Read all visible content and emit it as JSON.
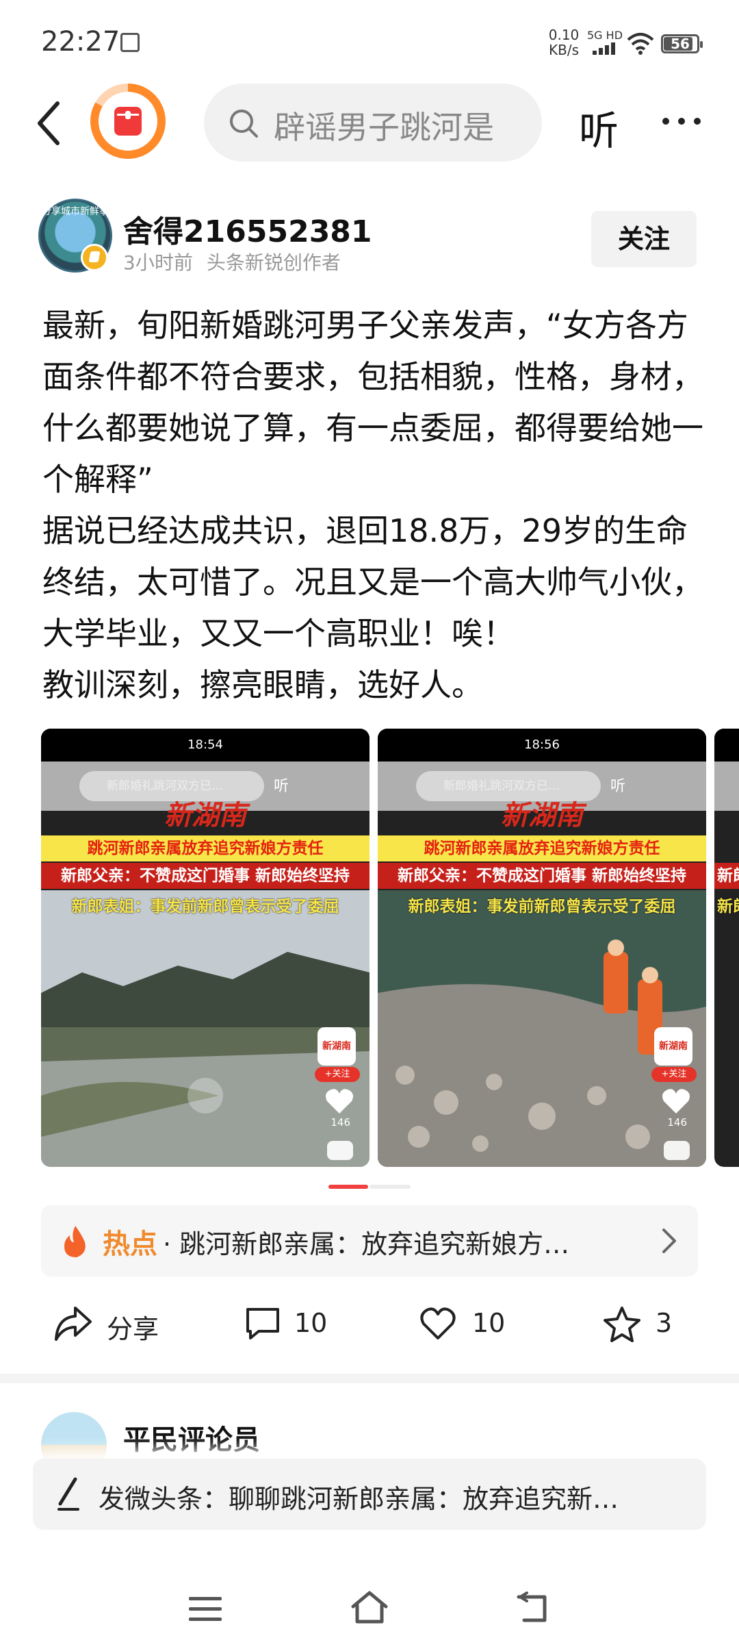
{
  "status_bar": {
    "time": "22:27",
    "net_speed_value": "0.10",
    "net_speed_unit": "KB/s",
    "net_type": "5G HD",
    "battery": "56"
  },
  "nav": {
    "search_placeholder": "辟谣男子跳河是",
    "listen_label": "听"
  },
  "author": {
    "avatar_tag": "分享城市新鲜事",
    "name": "舍得216552381",
    "time_ago": "3小时前",
    "role": "头条新锐创作者",
    "follow_label": "关注"
  },
  "article": {
    "paragraphs": [
      "最新，旬阳新婚跳河男子父亲发声，“女方各方面条件都不符合要求，包括相貌，性格，身材，什么都要她说了算，有一点委屈，都得要给她一个解释”",
      "据说已经达成共识，退回18.8万，29岁的生命终结，太可惜了。况且又是一个高大帅气小伙，大学毕业，又又一个高职业！唉！",
      "教训深刻，擦亮眼睛，选好人。"
    ]
  },
  "images": [
    {
      "time": "18:54",
      "search": "新郎婚礼跳河双方已…",
      "listen": "听",
      "brand": "新湖南",
      "caption1": "跳河新郎亲属放弃追究新娘方责任",
      "caption2": "新郎父亲：不赞成这门婚事 新郎始终坚持",
      "caption3": "新郎表姐：事发前新郎曾表示受了委屈",
      "logo": "新湖南",
      "follow": "+关注",
      "likes": "146"
    },
    {
      "time": "18:56",
      "search": "新郎婚礼跳河双方已…",
      "listen": "听",
      "brand": "新湖南",
      "caption1": "跳河新郎亲属放弃追究新娘方责任",
      "caption2": "新郎父亲：不赞成这门婚事 新郎始终坚持",
      "caption3": "新郎表姐：事发前新郎曾表示受了委屈",
      "logo": "新湖南",
      "follow": "+关注",
      "likes": "146"
    },
    {
      "caption2": "新郎",
      "caption3": "新郎"
    }
  ],
  "hot": {
    "label": "热点",
    "text": "· 跳河新郎亲属：放弃追究新娘方…"
  },
  "actions": {
    "share": "分享",
    "comments": "10",
    "likes": "10",
    "favorites": "3"
  },
  "next_card": {
    "name": "平民评论员"
  },
  "compose": {
    "text": "发微头条：聊聊跳河新郎亲属：放弃追究新…"
  },
  "colors": {
    "hot_orange": "#f08a2e",
    "accent_red": "#f04040"
  }
}
